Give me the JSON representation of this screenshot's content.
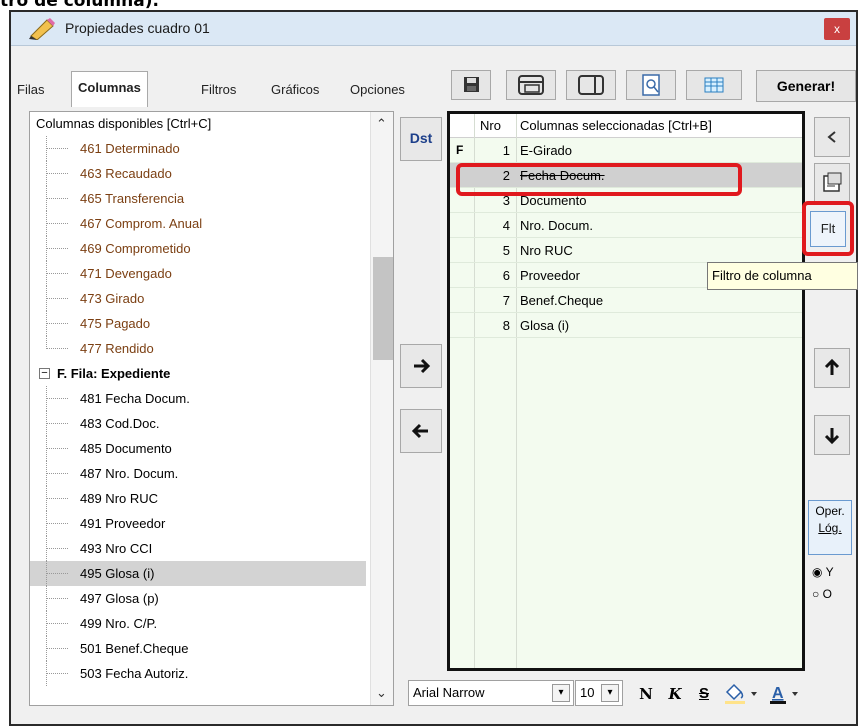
{
  "doc_heading": "tro de columna).",
  "window": {
    "title": "Propiedades cuadro 01",
    "close_label": "x"
  },
  "tabs": [
    {
      "label": "Filas"
    },
    {
      "label": "Columnas"
    },
    {
      "label": "Filtros"
    },
    {
      "label": "Gráficos"
    },
    {
      "label": "Opciones"
    }
  ],
  "toolbar": {
    "generate_label": "Generar!",
    "icons": [
      "save-icon",
      "window-icon",
      "panel-icon",
      "preview-icon",
      "grid-icon"
    ]
  },
  "left_panel": {
    "header": "Columnas disponibles     [Ctrl+C]",
    "items_top": [
      {
        "label": "461 Determinado"
      },
      {
        "label": "463 Recaudado"
      },
      {
        "label": "465 Transferencia"
      },
      {
        "label": "467 Comprom. Anual"
      },
      {
        "label": "469 Comprometido"
      },
      {
        "label": "471 Devengado"
      },
      {
        "label": "473 Girado"
      },
      {
        "label": "475 Pagado"
      },
      {
        "label": "477 Rendido"
      }
    ],
    "group": {
      "label": "F. Fila: Expediente",
      "toggle": "−"
    },
    "items_group": [
      {
        "label": "481 Fecha Docum."
      },
      {
        "label": "483 Cod.Doc."
      },
      {
        "label": "485 Documento"
      },
      {
        "label": "487 Nro. Docum."
      },
      {
        "label": "489 Nro RUC"
      },
      {
        "label": "491 Proveedor"
      },
      {
        "label": "493 Nro CCI"
      },
      {
        "label": "495 Glosa (i)"
      },
      {
        "label": "497 Glosa (p)"
      },
      {
        "label": "499 Nro. C/P."
      },
      {
        "label": "501 Benef.Cheque"
      },
      {
        "label": "503 Fecha Autoriz."
      }
    ],
    "selected_item": "495 Glosa (i)"
  },
  "middle": {
    "dst_label": "Dst",
    "add_arrow": "➔",
    "remove_arrow": "🡐"
  },
  "right_panel": {
    "header_nro": "Nro",
    "header_col": "Columnas seleccionadas   [Ctrl+B]",
    "rows": [
      {
        "marker": "F",
        "num": "1",
        "name": "E-Girado"
      },
      {
        "marker": "",
        "num": "2",
        "name": "Fecha Docum."
      },
      {
        "marker": "",
        "num": "3",
        "name": "Documento"
      },
      {
        "marker": "",
        "num": "4",
        "name": "Nro. Docum."
      },
      {
        "marker": "",
        "num": "5",
        "name": "Nro RUC"
      },
      {
        "marker": "",
        "num": "6",
        "name": "Proveedor"
      },
      {
        "marker": "",
        "num": "7",
        "name": "Benef.Cheque"
      },
      {
        "marker": "",
        "num": "8",
        "name": "Glosa (i)"
      }
    ],
    "selected_row": 2
  },
  "side_buttons": {
    "flt_label": "Flt",
    "up_arrow": "🡑",
    "down_arrow": "🡓",
    "tooltip": "Filtro de columna"
  },
  "oper": {
    "label_line1": "Oper.",
    "label_line2": "Lóg.",
    "option_y": "Y",
    "option_o": "O",
    "selected": "Y"
  },
  "format_bar": {
    "font": "Arial Narrow",
    "size": "10",
    "bold": "N",
    "italic": "K",
    "strike": "S"
  },
  "colors": {
    "accent_red": "#e0191e",
    "item_brown": "#7b3f12",
    "grid_bg": "#f3fbef"
  }
}
